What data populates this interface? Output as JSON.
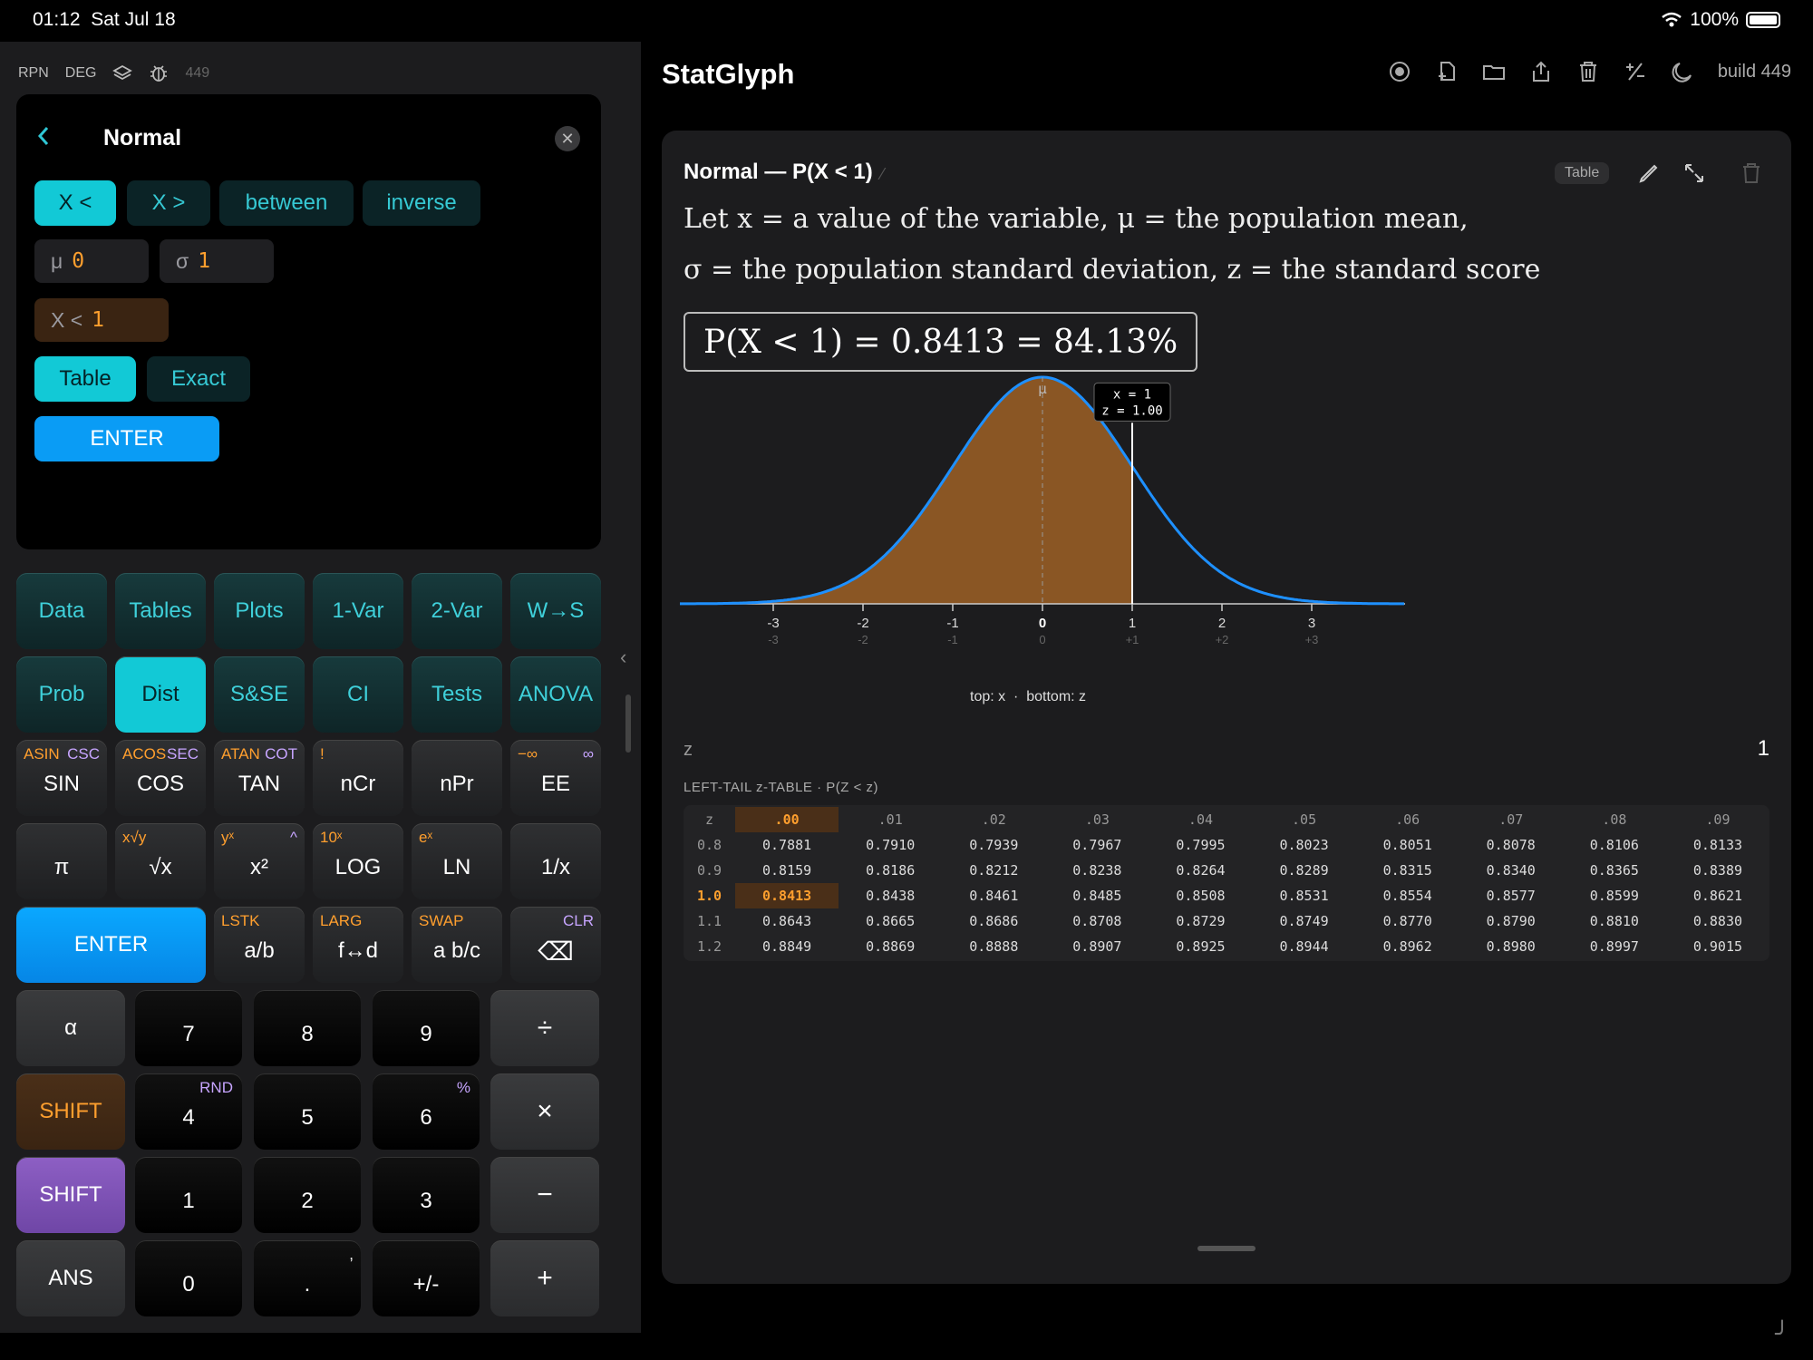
{
  "status": {
    "time": "01:12",
    "date": "Sat Jul 18",
    "battery": "100%"
  },
  "calc": {
    "modes": [
      "RPN",
      "DEG"
    ],
    "build_dim": "449",
    "panel": {
      "title": "Normal",
      "chips": [
        "X <",
        "X >",
        "between",
        "inverse"
      ],
      "mu_label": "μ",
      "mu_value": "0",
      "sigma_label": "σ",
      "sigma_value": "1",
      "x_label": "X <",
      "x_value": "1",
      "table_label": "Table",
      "exact_label": "Exact",
      "enter_label": "ENTER"
    },
    "row1": [
      "Data",
      "Tables",
      "Plots",
      "1-Var",
      "2-Var",
      "W→S"
    ],
    "row2": [
      "Prob",
      "Dist",
      "S&SE",
      "CI",
      "Tests",
      "ANOVA"
    ],
    "row3": [
      {
        "l": "ASIN",
        "r": "CSC",
        "main": "SIN"
      },
      {
        "l": "ACOS",
        "r": "SEC",
        "main": "COS"
      },
      {
        "l": "ATAN",
        "r": "COT",
        "main": "TAN"
      },
      {
        "l": "!",
        "r": "",
        "main": "nCr"
      },
      {
        "l": "",
        "r": "",
        "main": "nPr"
      },
      {
        "l": "−∞",
        "r": "∞",
        "main": "EE"
      }
    ],
    "row4": [
      {
        "l": "",
        "r": "",
        "main": "π"
      },
      {
        "l": "x√y",
        "r": "",
        "main": "√x"
      },
      {
        "l": "yˣ",
        "r": "^",
        "main": "x²"
      },
      {
        "l": "10ˣ",
        "r": "",
        "main": "LOG"
      },
      {
        "l": "eˣ",
        "r": "",
        "main": "LN"
      },
      {
        "l": "",
        "r": "",
        "main": "1/x"
      }
    ],
    "row5": {
      "enter": "ENTER",
      "keys": [
        {
          "l": "LSTK",
          "main": "a/b"
        },
        {
          "l": "LARG",
          "main": "f↔d"
        },
        {
          "l": "SWAP",
          "main": "a b/c"
        }
      ],
      "clr": "CLR",
      "backspace": "⌫"
    },
    "numpad": {
      "alpha": "α",
      "shift1": "SHIFT",
      "shift2": "SHIFT",
      "ans": "ANS",
      "n7": "7",
      "n8": "8",
      "n9": "9",
      "n4": "4",
      "rnd": "RND",
      "n5": "5",
      "n6": "6",
      "pct": "%",
      "n1": "1",
      "n2": "2",
      "n3": "3",
      "n0": "0",
      "dot": ".",
      "comma": ",",
      "neg": "+/-",
      "div": "÷",
      "mul": "×",
      "sub": "−",
      "add": "+"
    }
  },
  "app": {
    "title": "StatGlyph",
    "build": "build 449",
    "toolbar_icons": [
      "record-icon",
      "new-file-icon",
      "folder-icon",
      "share-icon",
      "trash-icon",
      "plus-minus-icon",
      "moon-icon"
    ]
  },
  "card": {
    "title": "Normal — P(X < 1)",
    "table_badge": "Table",
    "desc_line1": "Let x = a value of the variable, μ = the population mean,",
    "desc_line2": "σ = the population standard deviation, z = the standard score",
    "result": "P(X < 1) = 0.8413 = 84.13%",
    "plot": {
      "mu_label": "μ",
      "tooltip_x": "x = 1",
      "tooltip_z": "z = 1.00",
      "x_ticks": [
        "-3",
        "-2",
        "-1",
        "0",
        "1",
        "2",
        "3"
      ],
      "z_ticks": [
        "-3",
        "-2",
        "-1",
        "0",
        "+1",
        "+2",
        "+3"
      ],
      "caption": "top: x  ·  bottom: z",
      "shade_to": 1,
      "colors": {
        "curve": "#1e90ff",
        "fill": "#8a5624"
      }
    },
    "z_label": "z",
    "z_value": "1",
    "ztable_title": "LEFT-TAIL z-TABLE · P(Z < z)",
    "ztable": {
      "headers": [
        "z",
        ".00",
        ".01",
        ".02",
        ".03",
        ".04",
        ".05",
        ".06",
        ".07",
        ".08",
        ".09"
      ],
      "rows": [
        [
          "0.8",
          "0.7881",
          "0.7910",
          "0.7939",
          "0.7967",
          "0.7995",
          "0.8023",
          "0.8051",
          "0.8078",
          "0.8106",
          "0.8133"
        ],
        [
          "0.9",
          "0.8159",
          "0.8186",
          "0.8212",
          "0.8238",
          "0.8264",
          "0.8289",
          "0.8315",
          "0.8340",
          "0.8365",
          "0.8389"
        ],
        [
          "1.0",
          "0.8413",
          "0.8438",
          "0.8461",
          "0.8485",
          "0.8508",
          "0.8531",
          "0.8554",
          "0.8577",
          "0.8599",
          "0.8621"
        ],
        [
          "1.1",
          "0.8643",
          "0.8665",
          "0.8686",
          "0.8708",
          "0.8729",
          "0.8749",
          "0.8770",
          "0.8790",
          "0.8810",
          "0.8830"
        ],
        [
          "1.2",
          "0.8849",
          "0.8869",
          "0.8888",
          "0.8907",
          "0.8925",
          "0.8944",
          "0.8962",
          "0.8980",
          "0.8997",
          "0.9015"
        ]
      ],
      "highlight_row": 2,
      "highlight_col": 1
    }
  }
}
